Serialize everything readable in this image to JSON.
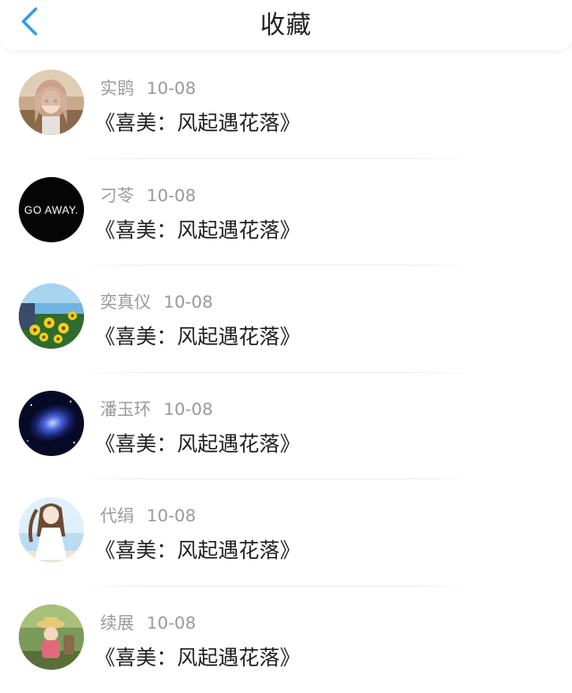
{
  "header": {
    "title": "收藏",
    "back_icon": "chevron-left-icon",
    "accent_color": "#2b9af3"
  },
  "items": [
    {
      "name": "实鹍",
      "date": "10-08",
      "content": "《喜美：风起遇花落》",
      "avatar": "anime-girl-avatar"
    },
    {
      "name": "刁苓",
      "date": "10-08",
      "content": "《喜美：风起遇花落》",
      "avatar": "go-away-text-avatar",
      "avatar_text": "GO AWAY."
    },
    {
      "name": "奕真仪",
      "date": "10-08",
      "content": "《喜美：风起遇花落》",
      "avatar": "sunflower-avatar"
    },
    {
      "name": "潘玉环",
      "date": "10-08",
      "content": "《喜美：风起遇花落》",
      "avatar": "galaxy-avatar"
    },
    {
      "name": "代绢",
      "date": "10-08",
      "content": "《喜美：风起遇花落》",
      "avatar": "anime-girl-beach-avatar"
    },
    {
      "name": "续展",
      "date": "10-08",
      "content": "《喜美：风起遇花落》",
      "avatar": "cartoon-scene-avatar"
    }
  ]
}
